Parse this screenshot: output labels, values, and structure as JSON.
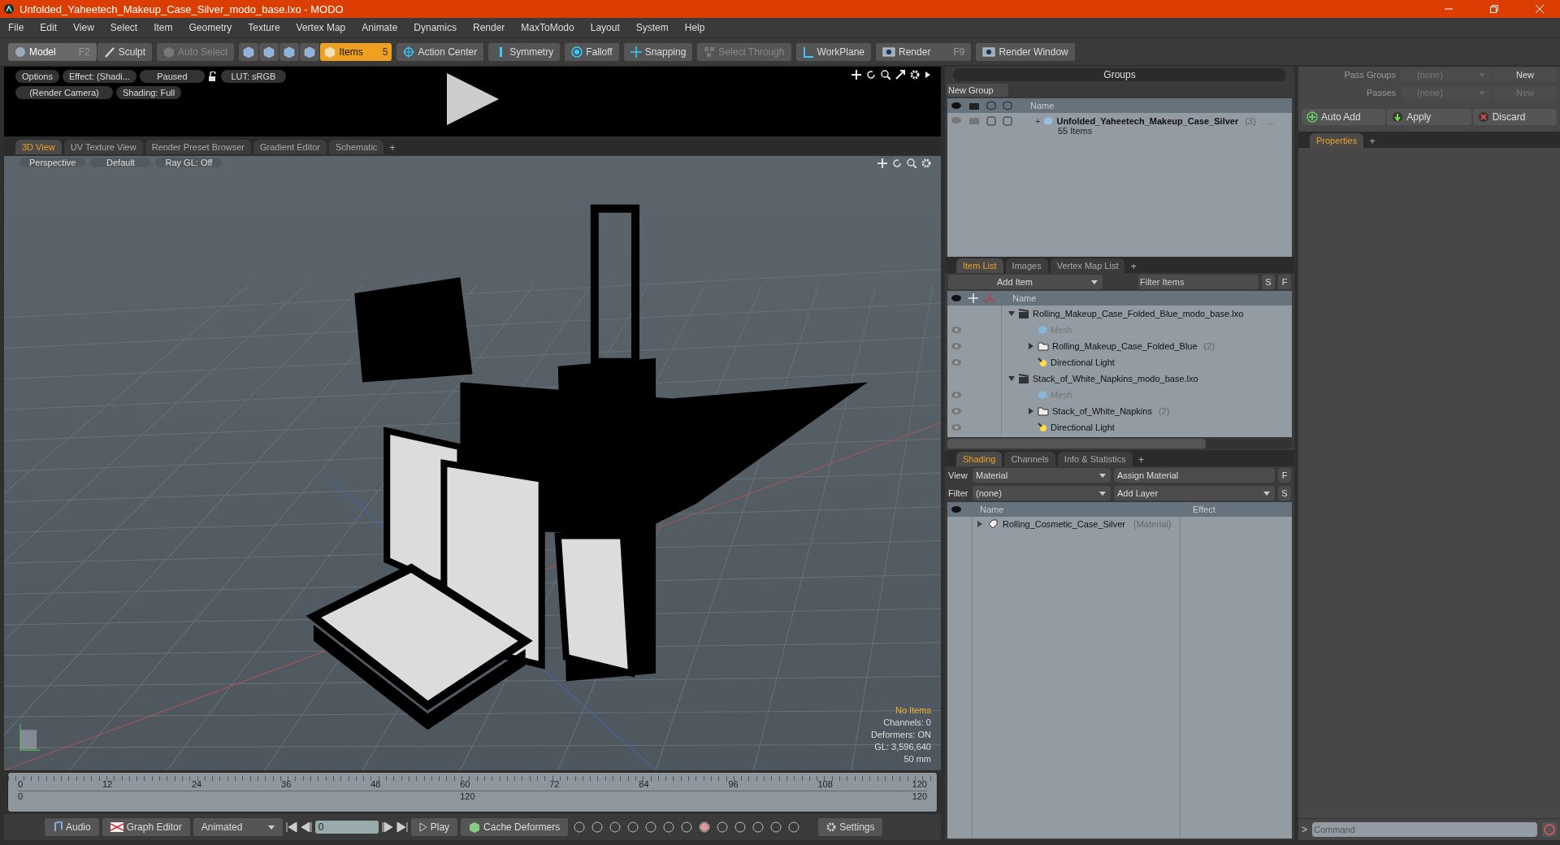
{
  "window": {
    "title": "Unfolded_Yaheetech_Makeup_Case_Silver_modo_base.lxo - MODO"
  },
  "menu": [
    "File",
    "Edit",
    "View",
    "Select",
    "Item",
    "Geometry",
    "Texture",
    "Vertex Map",
    "Animate",
    "Dynamics",
    "Render",
    "MaxToModo",
    "Layout",
    "System",
    "Help"
  ],
  "toolbar": {
    "mode": [
      {
        "label": "Model",
        "shortcut": "F2",
        "selected": true
      },
      {
        "label": "Sculpt",
        "selected": false
      }
    ],
    "auto_select": {
      "label": "Auto Select",
      "disabled": true
    },
    "selection_modes": [
      {
        "selected": false
      },
      {
        "selected": false
      },
      {
        "selected": false
      },
      {
        "selected": false
      },
      {
        "label": "Items",
        "count": "5",
        "selected": true
      }
    ],
    "tools": [
      {
        "label": "Action Center",
        "disabled": false
      },
      {
        "label": "Symmetry",
        "disabled": false
      },
      {
        "label": "Falloff",
        "disabled": false
      },
      {
        "label": "Snapping",
        "disabled": false
      },
      {
        "label": "Select Through",
        "disabled": true
      },
      {
        "label": "WorkPlane",
        "disabled": false
      },
      {
        "label": "Render",
        "shortcut": "F9",
        "disabled": false
      },
      {
        "label": "Render Window",
        "disabled": false
      }
    ]
  },
  "preview": {
    "row_1": [
      "Options",
      "Effect: (Shadi...",
      "Paused"
    ],
    "lut": "LUT: sRGB",
    "row_2": [
      "(Render Camera)",
      "Shading: Full"
    ]
  },
  "viewport_tabs": [
    {
      "label": "3D View",
      "selected": true
    },
    {
      "label": "UV Texture View",
      "selected": false
    },
    {
      "label": "Render Preset Browser",
      "selected": false
    },
    {
      "label": "Gradient Editor",
      "selected": false
    },
    {
      "label": "Schematic",
      "selected": false
    }
  ],
  "viewport_tabs_add": "+",
  "viewport": {
    "buttons": [
      "Perspective",
      "Default",
      "Ray GL: Off"
    ],
    "info_title": "No Items",
    "info": [
      "Channels: 0",
      "Deformers: ON",
      "GL: 3,596,640",
      "50 mm"
    ]
  },
  "timeline": {
    "ticks": [
      "0",
      "12",
      "24",
      "36",
      "48",
      "60",
      "72",
      "84",
      "96",
      "108",
      "120"
    ],
    "range": [
      "0",
      "120",
      "120"
    ]
  },
  "bottom_bar": {
    "audio": "Audio",
    "graph_editor": "Graph Editor",
    "mode": "Animated",
    "frame": "0",
    "play": "Play",
    "cache": "Cache Deformers",
    "settings": "Settings"
  },
  "groups": {
    "title": "Groups",
    "new_group": "New Group",
    "column": "Name",
    "rows": [
      {
        "expand_sign": "+",
        "name": "Unfolded_Yaheetech_Makeup_Case_Silver",
        "count": "(3)",
        "suffix": ": ...",
        "subtitle": "55 Items"
      }
    ]
  },
  "item_list": {
    "tabs": [
      {
        "label": "Item List",
        "selected": true
      },
      {
        "label": "Images",
        "selected": false
      },
      {
        "label": "Vertex Map List",
        "selected": false
      }
    ],
    "tabs_add": "+",
    "add_item": "Add Item",
    "filter": {
      "placeholder": "Filter Items"
    },
    "buttons": [
      "S",
      "F"
    ],
    "column": "Name",
    "tree": [
      {
        "kind": "scene",
        "name": "Rolling_Makeup_Case_Folded_Blue_modo_base.lxo",
        "visible": false,
        "disabled": false,
        "expanded": true,
        "children": [
          {
            "kind": "mesh",
            "name": "Mesh",
            "visible": true,
            "disabled": true
          },
          {
            "kind": "group",
            "name": "Rolling_Makeup_Case_Folded_Blue",
            "count": "(2)",
            "visible": true,
            "disabled": false,
            "expanded": false
          },
          {
            "kind": "light",
            "name": "Directional Light",
            "visible": true,
            "disabled": false
          }
        ]
      },
      {
        "kind": "scene",
        "name": "Stack_of_White_Napkins_modo_base.lxo",
        "visible": false,
        "disabled": false,
        "expanded": true,
        "children": [
          {
            "kind": "mesh",
            "name": "Mesh",
            "visible": true,
            "disabled": true
          },
          {
            "kind": "group",
            "name": "Stack_of_White_Napkins",
            "count": "(2)",
            "visible": true,
            "disabled": false,
            "expanded": false
          },
          {
            "kind": "light",
            "name": "Directional Light",
            "visible": true,
            "disabled": false
          }
        ]
      }
    ]
  },
  "shading": {
    "tabs": [
      {
        "label": "Shading",
        "selected": true
      },
      {
        "label": "Channels",
        "selected": false
      },
      {
        "label": "Info & Statistics",
        "selected": false
      }
    ],
    "tabs_add": "+",
    "view_label": "View",
    "view_value": "Material",
    "assign": "Assign Material",
    "filter_label": "Filter",
    "filter_value": "(none)",
    "add_layer": "Add Layer",
    "buttons": [
      "F",
      "S"
    ],
    "columns": [
      "Name",
      "Effect"
    ],
    "rows": [
      {
        "name": "Rolling_Cosmetic_Case_Silver",
        "type": "(Material)"
      }
    ]
  },
  "passes": {
    "pass_groups_label": "Pass Groups",
    "pass_groups_value": "(none)",
    "pass_groups_button": {
      "label": "New",
      "disabled": false
    },
    "passes_label": "Passes",
    "passes_value": "(none)",
    "passes_button": {
      "label": "New",
      "disabled": true
    },
    "actions": [
      "Auto Add",
      "Apply",
      "Discard"
    ]
  },
  "properties": {
    "tabs": [
      {
        "label": "Properties",
        "selected": true
      }
    ],
    "tabs_add": "+"
  },
  "command": {
    "prompt": ">",
    "placeholder": "Command"
  }
}
